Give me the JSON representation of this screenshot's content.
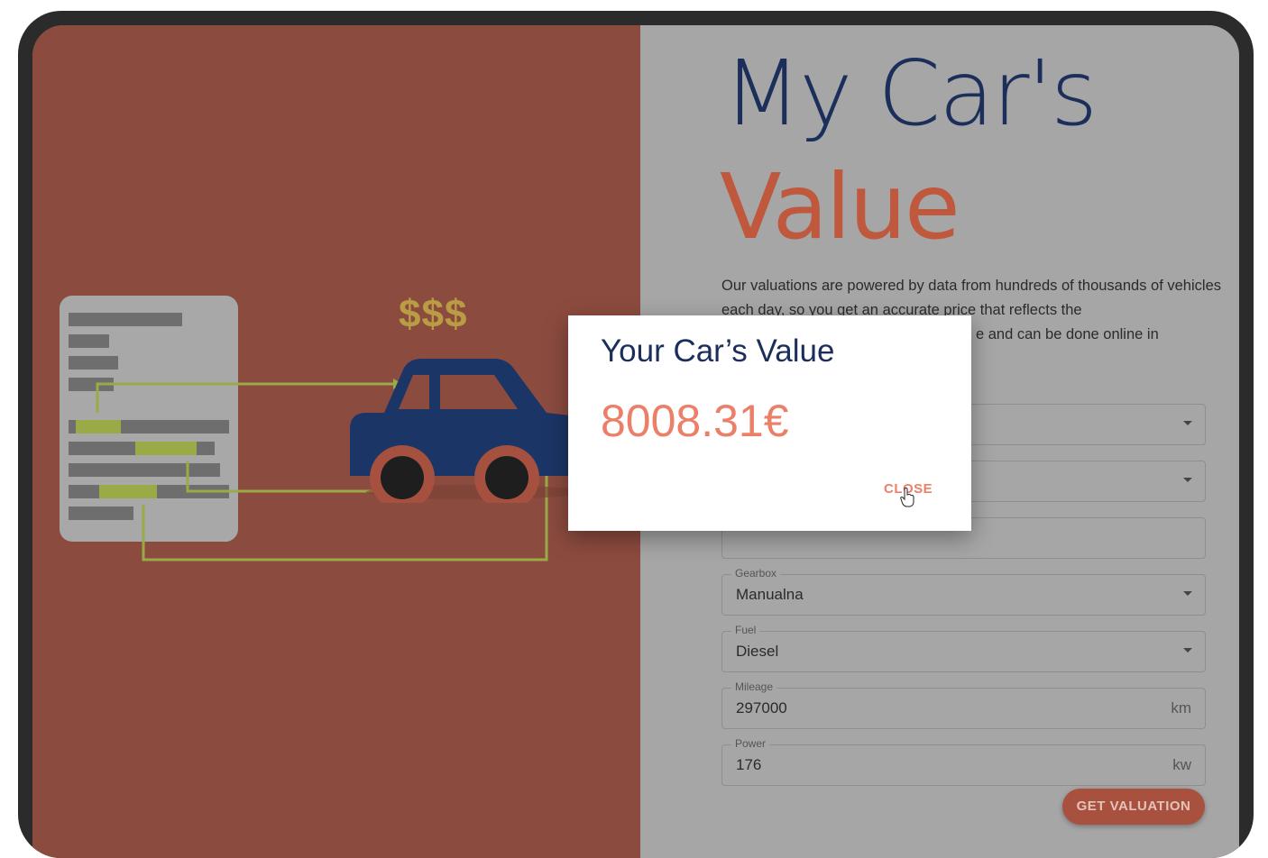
{
  "hero": {
    "title_line1": "My Car's",
    "title_line2": "Value",
    "description": "Our valuations are powered by data from hundreds of thousands of vehicles each day, so you get an accurate price that reflects the",
    "description_partial": "e and can be done online in"
  },
  "illustration": {
    "dollars": "$$$"
  },
  "form": {
    "gearbox": {
      "label": "Gearbox",
      "value": "Manualna"
    },
    "fuel": {
      "label": "Fuel",
      "value": "Diesel"
    },
    "mileage": {
      "label": "Mileage",
      "value": "297000",
      "unit": "km"
    },
    "power": {
      "label": "Power",
      "value": "176",
      "unit": "kw"
    },
    "submit_label": "GET VALUATION"
  },
  "modal": {
    "title": "Your Car’s Value",
    "value": "8008.31€",
    "close_label": "CLOSE"
  },
  "colors": {
    "navy": "#1b2f5a",
    "coral": "#ec7f68",
    "left_panel": "#8c4b3f",
    "right_panel": "#a6a6a6"
  }
}
